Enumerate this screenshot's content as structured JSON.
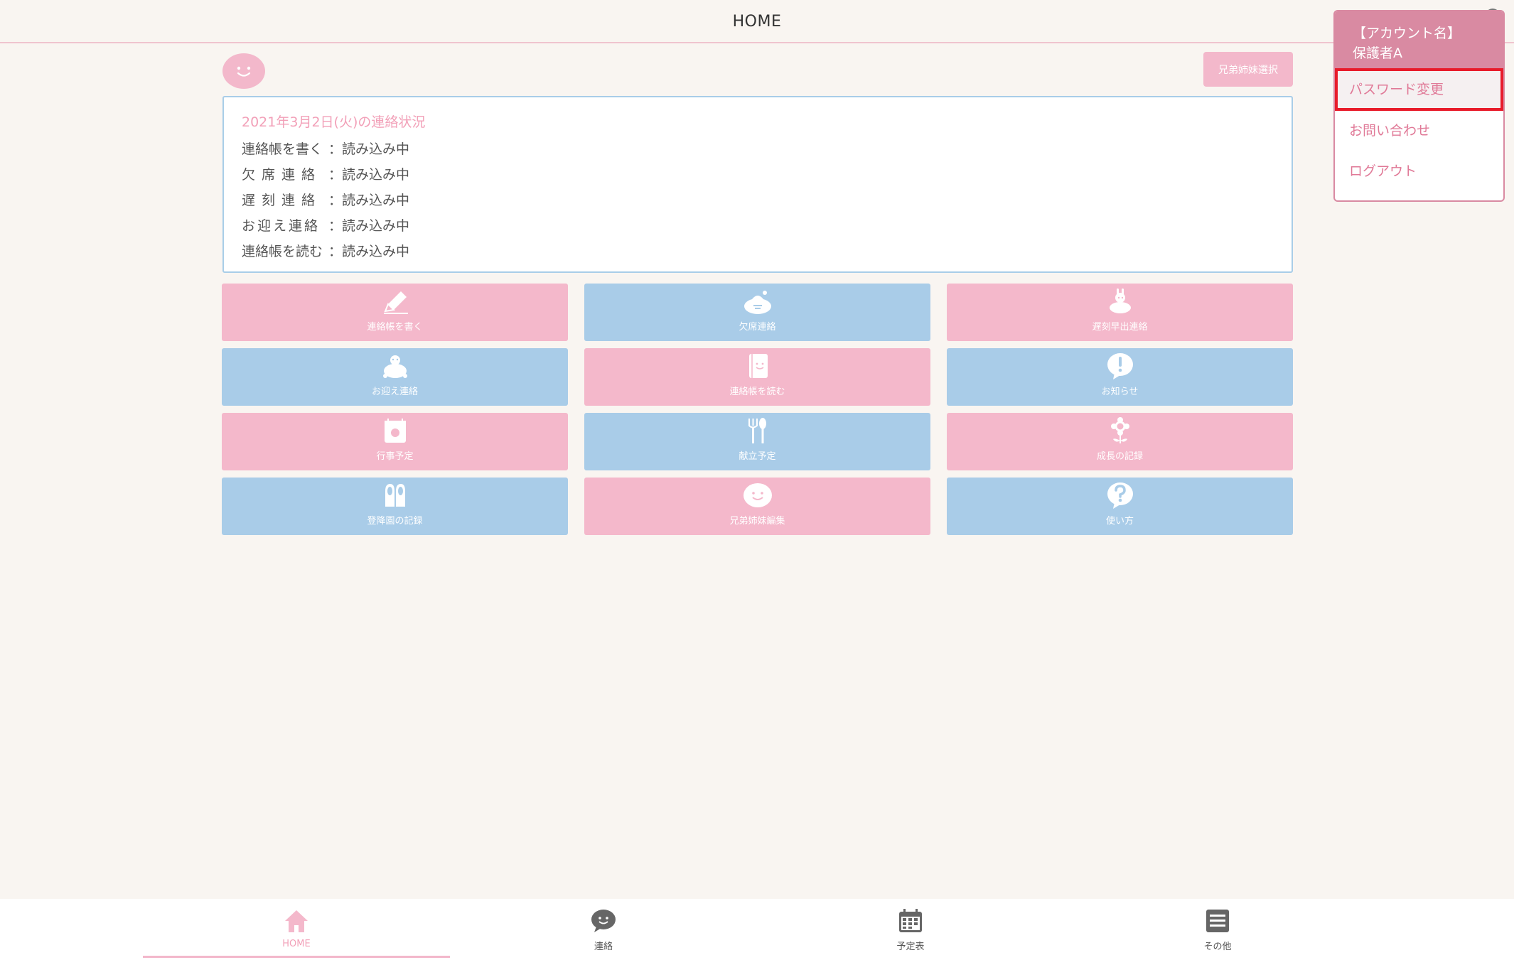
{
  "header": {
    "title": "HOME"
  },
  "sibling_select_label": "兄弟姉妹選択",
  "status": {
    "heading": "2021年3月2日(火)の連絡状況",
    "rows": [
      {
        "label": "連絡帳を書く",
        "value": "：読み込み中"
      },
      {
        "label": "欠席連絡",
        "value": "：読み込み中"
      },
      {
        "label": "遅刻連絡",
        "value": "：読み込み中"
      },
      {
        "label": "お迎え連絡",
        "value": "：読み込み中"
      },
      {
        "label": "連絡帳を読む",
        "value": "：読み込み中"
      }
    ]
  },
  "tiles": [
    {
      "label": "連絡帳を書く",
      "icon": "pencil-icon",
      "color": "#f4b8cb"
    },
    {
      "label": "欠席連絡",
      "icon": "sleeping-turtle-icon",
      "color": "#a9cce8"
    },
    {
      "label": "遅刻早出連絡",
      "icon": "turtle-rabbit-icon",
      "color": "#f4b8cb"
    },
    {
      "label": "お迎え連絡",
      "icon": "turtle-icon",
      "color": "#a9cce8"
    },
    {
      "label": "連絡帳を読む",
      "icon": "notebook-icon",
      "color": "#f4b8cb"
    },
    {
      "label": "お知らせ",
      "icon": "exclamation-bubble-icon",
      "color": "#a9cce8"
    },
    {
      "label": "行事予定",
      "icon": "calendar-icon",
      "color": "#f4b8cb"
    },
    {
      "label": "献立予定",
      "icon": "fork-spoon-icon",
      "color": "#a9cce8"
    },
    {
      "label": "成長の記録",
      "icon": "flower-icon",
      "color": "#f4b8cb"
    },
    {
      "label": "登降園の記録",
      "icon": "shoes-icon",
      "color": "#a9cce8"
    },
    {
      "label": "兄弟姉妹編集",
      "icon": "smile-bubble-icon",
      "color": "#f4b8cb"
    },
    {
      "label": "使い方",
      "icon": "question-bubble-icon",
      "color": "#a9cce8"
    }
  ],
  "account_menu": {
    "account_label": "【アカウント名】",
    "account_name": "保護者A",
    "items": [
      "パスワード変更",
      "お問い合わせ",
      "ログアウト"
    ]
  },
  "bottom_nav": [
    {
      "label": "HOME",
      "icon": "home-icon"
    },
    {
      "label": "連絡",
      "icon": "chat-icon"
    },
    {
      "label": "予定表",
      "icon": "calendar-icon"
    },
    {
      "label": "その他",
      "icon": "menu-list-icon"
    }
  ],
  "colors": {
    "pink": "#f4b8cb",
    "blue": "#a9cce8",
    "accent": "#d98aa2",
    "highlight_border": "#e81b2a"
  }
}
